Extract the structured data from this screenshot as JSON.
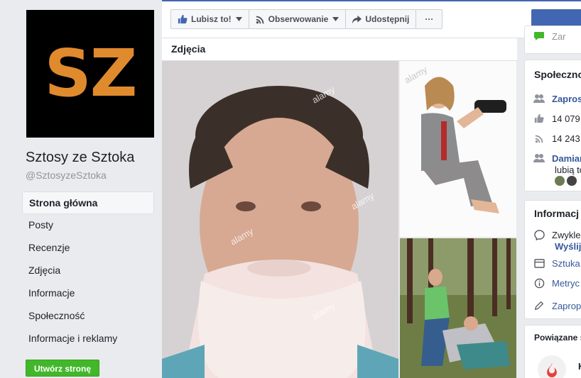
{
  "page": {
    "logo_text": "SZ",
    "name": "Sztosy ze Sztoka",
    "handle": "@SztosyzeSztoka"
  },
  "nav": {
    "items": [
      {
        "label": "Strona główna",
        "active": true
      },
      {
        "label": "Posty"
      },
      {
        "label": "Recenzje"
      },
      {
        "label": "Zdjęcia"
      },
      {
        "label": "Informacje"
      },
      {
        "label": "Społeczność"
      },
      {
        "label": "Informacje i reklamy"
      }
    ],
    "create_page": "Utwórz stronę"
  },
  "actions": {
    "like": "Lubisz to!",
    "follow": "Obserwowanie",
    "share": "Udostępnij",
    "more": "···"
  },
  "photos": {
    "title": "Zdjęcia",
    "watermark": "alamy"
  },
  "right": {
    "top_link": "Zar",
    "community": {
      "title": "Społeczno",
      "invite": "Zapros",
      "likes": "14 079",
      "follows": "14 243",
      "friend": "Damian",
      "friend_sub": "lubią to"
    },
    "info": {
      "title": "Informacj",
      "line1": "Zwykle",
      "line1b": "Wyślij",
      "category": "Sztuka",
      "metric": "Metryc",
      "suggest": "Zaprop"
    },
    "related": {
      "title": "Powiązane s"
    }
  },
  "colors": {
    "facebook_blue": "#4267b2",
    "green": "#42b72a",
    "logo_orange": "#e08a2e",
    "link": "#365899"
  }
}
